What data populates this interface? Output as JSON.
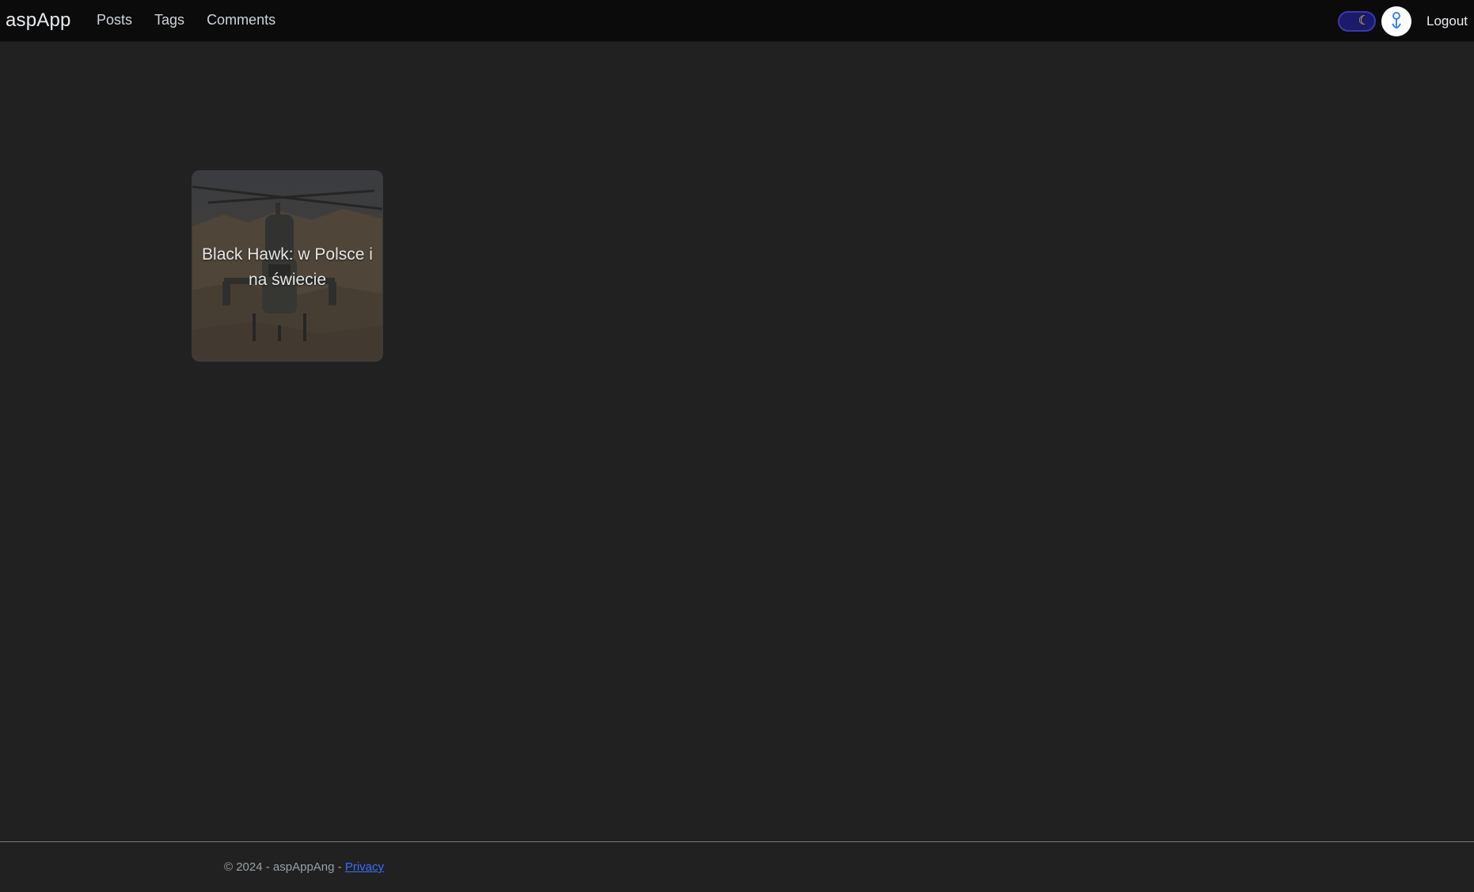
{
  "header": {
    "brand": "aspApp",
    "nav": [
      "Posts",
      "Tags",
      "Comments"
    ],
    "theme_toggle": {
      "icon": "moon-icon",
      "state": "dark",
      "track_color": "#1b1a6b",
      "icon_color": "#f5d64a"
    },
    "avatar_icon": "person-pin-icon",
    "logout_label": "Logout"
  },
  "posts": [
    {
      "title": "Black Hawk: w Polsce i na świecie",
      "image": "helicopter-photo"
    }
  ],
  "footer": {
    "copyright": "© 2024 - aspAppAng - ",
    "privacy_label": "Privacy",
    "link_color": "#3d6dfc"
  }
}
